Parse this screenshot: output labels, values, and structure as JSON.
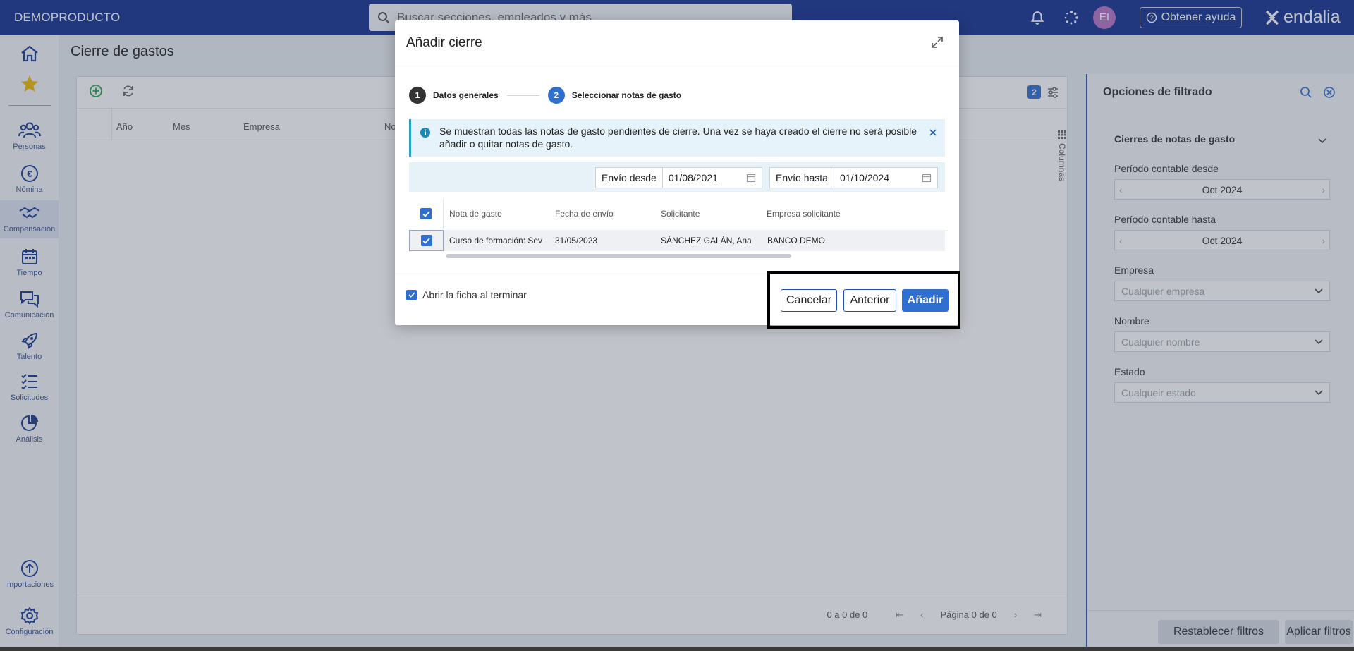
{
  "topbar": {
    "brand": "DEMOPRODUCTO",
    "search_placeholder": "Buscar secciones, empleados y más",
    "avatar_initials": "EI",
    "help_label": "Obtener ayuda",
    "logo_text": "endalia"
  },
  "sidebar": {
    "items": [
      {
        "label": "Personas",
        "icon": "people-icon"
      },
      {
        "label": "Nómina",
        "icon": "euro-icon"
      },
      {
        "label": "Compensación",
        "icon": "handshake-icon"
      },
      {
        "label": "Tiempo",
        "icon": "calendar-icon"
      },
      {
        "label": "Comunicación",
        "icon": "chat-icon"
      },
      {
        "label": "Talento",
        "icon": "rocket-icon"
      },
      {
        "label": "Solicitudes",
        "icon": "checklist-icon"
      },
      {
        "label": "Análisis",
        "icon": "pie-chart-icon"
      },
      {
        "label": "Importaciones",
        "icon": "upload-icon"
      },
      {
        "label": "Configuración",
        "icon": "gear-icon"
      }
    ]
  },
  "page": {
    "title": "Cierre de gastos",
    "columns": [
      "Año",
      "Mes",
      "Empresa",
      "No"
    ],
    "columns_panel_label": "Columnas",
    "filter_badge": "2",
    "pagination": {
      "summary": "0 a 0 de 0",
      "page_label": "Página 0 de 0"
    }
  },
  "filters": {
    "title": "Opciones de filtrado",
    "section": "Cierres de notas de gasto",
    "period_from_label": "Período contable desde",
    "period_from_value": "Oct 2024",
    "period_to_label": "Período contable hasta",
    "period_to_value": "Oct 2024",
    "company_label": "Empresa",
    "company_placeholder": "Cualquier empresa",
    "name_label": "Nombre",
    "name_placeholder": "Cualquier nombre",
    "status_label": "Estado",
    "status_placeholder": "Cualqueir estado",
    "reset_label": "Restablecer filtros",
    "apply_label": "Aplicar filtros"
  },
  "modal": {
    "title": "Añadir cierre",
    "steps": [
      {
        "num": "1",
        "label": "Datos generales"
      },
      {
        "num": "2",
        "label": "Seleccionar notas de gasto"
      }
    ],
    "info_text": "Se muestran todas las notas de gasto pendientes de cierre. Una vez se haya creado el cierre no será posible añadir o quitar notas de gasto.",
    "date_from_label": "Envío desde",
    "date_from_value": "01/08/2021",
    "date_to_label": "Envío hasta",
    "date_to_value": "01/10/2024",
    "grid_headers": [
      "Nota de gasto",
      "Fecha de envío",
      "Solicitante",
      "Empresa solicitante"
    ],
    "grid_row": [
      "Curso de formación: Sev",
      "31/05/2023",
      "SÁNCHEZ GALÁN, Ana",
      "BANCO DEMO"
    ],
    "open_on_finish_label": "Abrir la ficha al terminar",
    "cancel_label": "Cancelar",
    "previous_label": "Anterior",
    "add_label": "Añadir"
  },
  "colors": {
    "topbar": "#17328f",
    "primary": "#2f6fd0",
    "info_bg": "#e6f3fa"
  }
}
